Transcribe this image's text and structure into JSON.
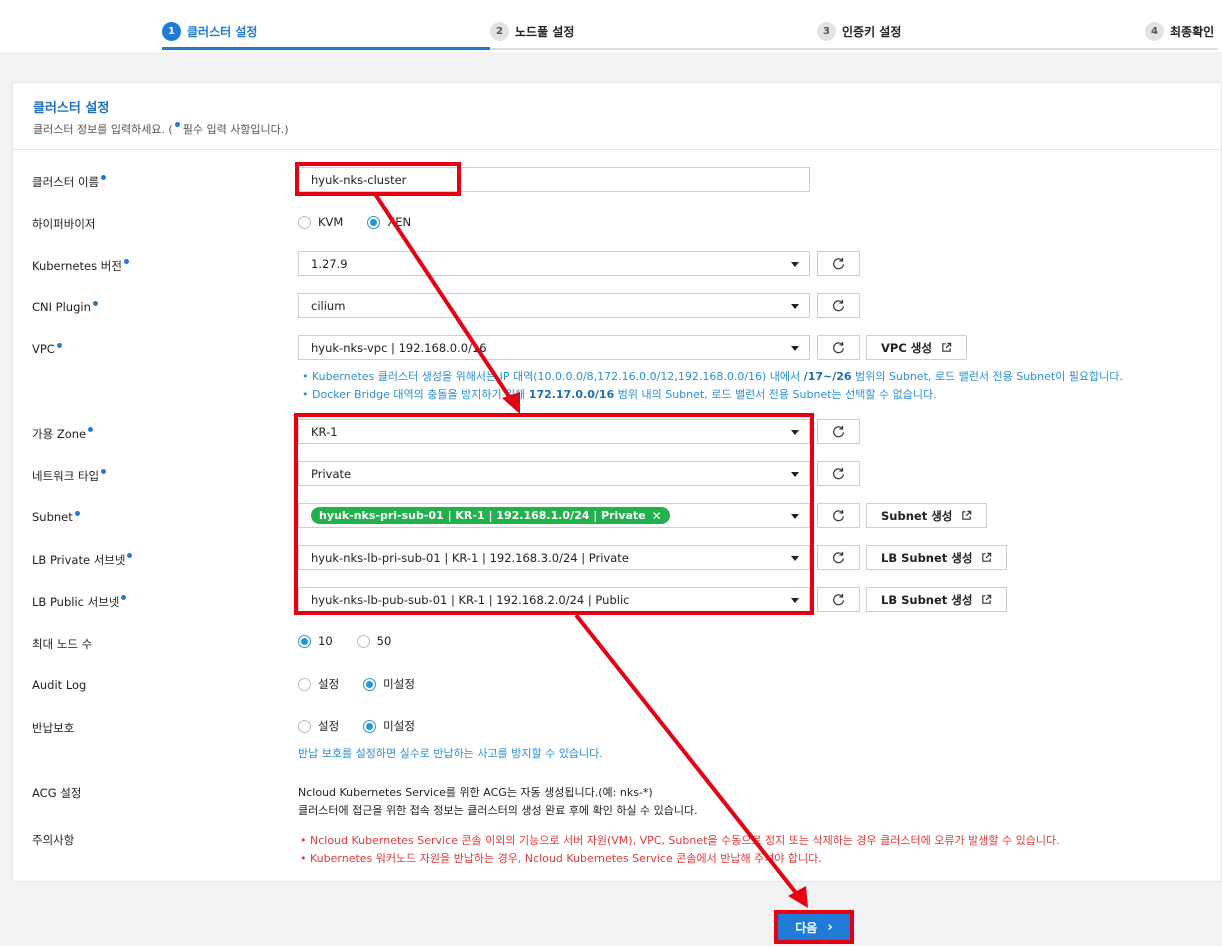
{
  "steps": [
    {
      "num": "1",
      "label": "클러스터 설정"
    },
    {
      "num": "2",
      "label": "노드풀 설정"
    },
    {
      "num": "3",
      "label": "인증키 설정"
    },
    {
      "num": "4",
      "label": "최종확인"
    }
  ],
  "card": {
    "title": "클러스터 설정",
    "desc_pre": "클러스터 정보를 입력하세요. (",
    "desc_post": "필수 입력 사항입니다.)"
  },
  "fields": {
    "cluster_name": {
      "label": "클러스터 이름",
      "value": "hyuk-nks-cluster"
    },
    "hypervisor": {
      "label": "하이퍼바이저",
      "options": [
        "KVM",
        "XEN"
      ],
      "selected": "XEN"
    },
    "k8s_version": {
      "label": "Kubernetes 버전",
      "value": "1.27.9"
    },
    "cni": {
      "label": "CNI Plugin",
      "value": "cilium"
    },
    "vpc": {
      "label": "VPC",
      "value": "hyuk-nks-vpc | 192.168.0.0/16",
      "create_label": "VPC 생성"
    },
    "vpc_notes": [
      {
        "pre": "Kubernetes 클러스터 생성을 위해서는 IP 대역(10.0.0.0/8,172.16.0.0/12,192.168.0.0/16) 내에서 ",
        "bold": "/17~/26",
        "post": " 범위의 Subnet, 로드 밸런서 전용 Subnet이 필요합니다."
      },
      {
        "pre": "Docker Bridge 대역의 충돌을 방지하기 위해 ",
        "bold": "172.17.0.0/16",
        "post": " 범위 내의 Subnet, 로드 밸런서 전용 Subnet는 선택할 수 없습니다."
      }
    ],
    "zone": {
      "label": "가용 Zone",
      "value": "KR-1"
    },
    "network_type": {
      "label": "네트워크 타입",
      "value": "Private"
    },
    "subnet": {
      "label": "Subnet",
      "tag": "hyuk-nks-pri-sub-01 | KR-1 | 192.168.1.0/24 | Private",
      "create_label": "Subnet 생성"
    },
    "lb_private": {
      "label": "LB Private 서브넷",
      "value": "hyuk-nks-lb-pri-sub-01 | KR-1 | 192.168.3.0/24 | Private",
      "create_label": "LB Subnet 생성"
    },
    "lb_public": {
      "label": "LB Public 서브넷",
      "value": "hyuk-nks-lb-pub-sub-01 | KR-1 | 192.168.2.0/24 | Public",
      "create_label": "LB Subnet 생성"
    },
    "max_nodes": {
      "label": "최대 노드 수",
      "options": [
        "10",
        "50"
      ],
      "selected": "10"
    },
    "audit_log": {
      "label": "Audit Log",
      "options": [
        "설정",
        "미설정"
      ],
      "selected": "미설정"
    },
    "return_protect": {
      "label": "반납보호",
      "options": [
        "설정",
        "미설정"
      ],
      "selected": "미설정",
      "note": "반납 보호를 설정하면 실수로 반납하는 사고를 방지할 수 있습니다."
    },
    "acg": {
      "label": "ACG 설정",
      "lines": [
        "Ncloud Kubernetes Service를 위한 ACG는 자동 생성됩니다.(예: nks-*)",
        "클러스터에 접근을 위한 접속 정보는 클러스터의 생성 완료 후에 확인 하실 수 있습니다."
      ]
    },
    "caution": {
      "label": "주의사항",
      "lines": [
        "Ncloud Kubernetes Service 콘솔 이외의 기능으로 서버 자원(VM), VPC, Subnet을 수동으로 정지 또는 삭제하는 경우 클러스터에 오류가 발생할 수 있습니다.",
        "Kubernetes 워커노드 자원을 반납하는 경우, Ncloud Kubernetes Service 콘솔에서 반납해 주셔야 합니다."
      ]
    }
  },
  "next_label": "다음",
  "colors": {
    "accent": "#1f7bd6",
    "highlight": "#e60012",
    "tag": "#22b14c",
    "warning": "#e03a3a"
  }
}
